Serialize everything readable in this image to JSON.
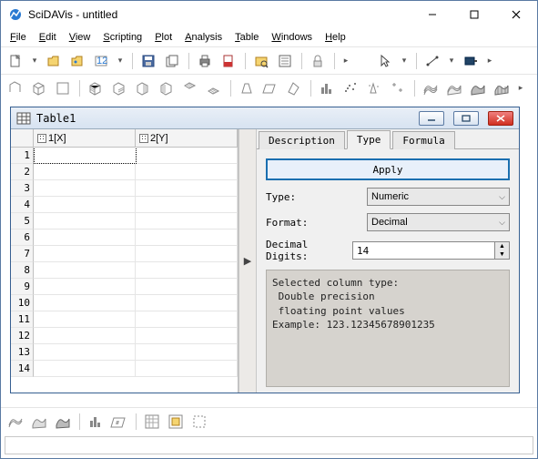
{
  "window": {
    "title": "SciDAVis - untitled"
  },
  "menu": {
    "file": "File",
    "edit": "Edit",
    "view": "View",
    "scripting": "Scripting",
    "plot": "Plot",
    "analysis": "Analysis",
    "table": "Table",
    "windows": "Windows",
    "help": "Help"
  },
  "subwindow": {
    "title": "Table1",
    "columns": [
      {
        "label": "1[X]"
      },
      {
        "label": "2[Y]"
      }
    ],
    "row_count": 14
  },
  "tabs": {
    "description": "Description",
    "type": "Type",
    "formula": "Formula",
    "active": "type"
  },
  "type_panel": {
    "apply": "Apply",
    "type_label": "Type:",
    "type_value": "Numeric",
    "format_label": "Format:",
    "format_value": "Decimal",
    "digits_label": "Decimal Digits:",
    "digits_value": "14",
    "info": "Selected column type:\n Double precision\n floating point values\nExample: 123.12345678901235"
  }
}
